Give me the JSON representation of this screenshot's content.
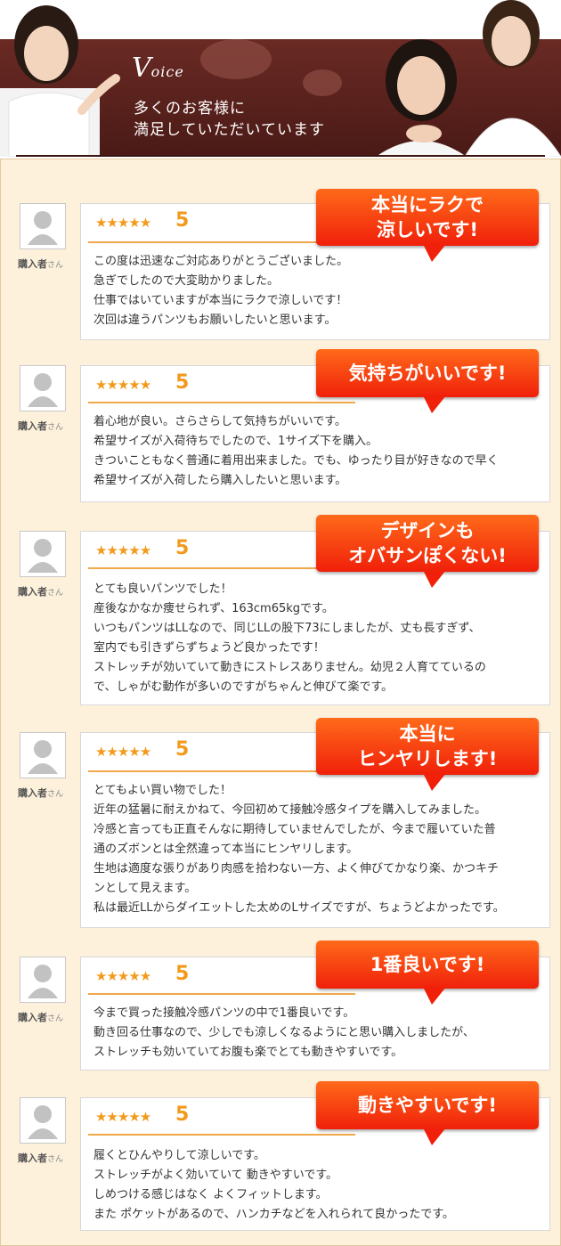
{
  "header": {
    "title_big": "V",
    "title_small": "oice",
    "subtitle_line1": "多くのお客様に",
    "subtitle_line2": "満足していただいています"
  },
  "reviews": [
    {
      "callout": [
        "本当にラクで",
        "涼しいです!"
      ],
      "buyer": "購入者",
      "suffix": "さん",
      "stars": "★★★★★",
      "score": "5",
      "lines": [
        "この度は迅速なご対応ありがとうございました。",
        "急ぎでしたので大変助かりました。",
        "仕事ではいていますが本当にラクで涼しいです！",
        "次回は違うパンツもお願いしたいと思います。"
      ]
    },
    {
      "callout": [
        "気持ちがいいです!"
      ],
      "buyer": "購入者",
      "suffix": "さん",
      "stars": "★★★★★",
      "score": "5",
      "lines": [
        "着心地が良い。さらさらして気持ちがいいです。",
        "希望サイズが入荷待ちでしたので、1サイズ下を購入。",
        "きついこともなく普通に着用出来ました。でも、ゆったり目が好きなので早く",
        "希望サイズが入荷したら購入したいと思います。"
      ]
    },
    {
      "callout": [
        "デザインも",
        "オバサンぽくない!"
      ],
      "buyer": "購入者",
      "suffix": "さん",
      "stars": "★★★★★",
      "score": "5",
      "lines": [
        "とても良いパンツでした！",
        "産後なかなか痩せられず、163cm65kgです。",
        "いつもパンツはLLなので、同じLLの股下73にしましたが、丈も長すぎず、",
        "室内でも引きずらずちょうど良かったです！",
        "ストレッチが効いていて動きにストレスありません。幼児２人育てているの",
        "で、しゃがむ動作が多いのですがちゃんと伸びて楽です。"
      ]
    },
    {
      "callout": [
        "本当に",
        "ヒンヤリします!"
      ],
      "buyer": "購入者",
      "suffix": "さん",
      "stars": "★★★★★",
      "score": "5",
      "lines": [
        "とてもよい買い物でした！",
        "近年の猛暑に耐えかねて、今回初めて接触冷感タイプを購入してみました。",
        "冷感と言っても正直そんなに期待していませんでしたが、今まで履いていた普",
        "通のズボンとは全然違って本当にヒンヤリします。",
        "生地は適度な張りがあり肉感を拾わない一方、よく伸びてかなり楽、かつキチ",
        "ンとして見えます。",
        "私は最近LLからダイエットした太めのLサイズですが、ちょうどよかったです。"
      ]
    },
    {
      "callout": [
        "1番良いです!"
      ],
      "buyer": "購入者",
      "suffix": "さん",
      "stars": "★★★★★",
      "score": "5",
      "lines": [
        "今まで買った接触冷感パンツの中で1番良いです。",
        "動き回る仕事なので、少しでも涼しくなるようにと思い購入しましたが、",
        "ストレッチも効いていてお腹も楽でとても動きやすいです。"
      ]
    },
    {
      "callout": [
        "動きやすいです!"
      ],
      "buyer": "購入者",
      "suffix": "さん",
      "stars": "★★★★★",
      "score": "5",
      "lines": [
        "履くとひんやりして涼しいです。",
        "ストレッチがよく効いていて 動きやすいです。",
        "しめつける感じはなく よくフィットします。",
        "また ポケットがあるので、ハンカチなどを入れられて良かったです。"
      ]
    }
  ]
}
